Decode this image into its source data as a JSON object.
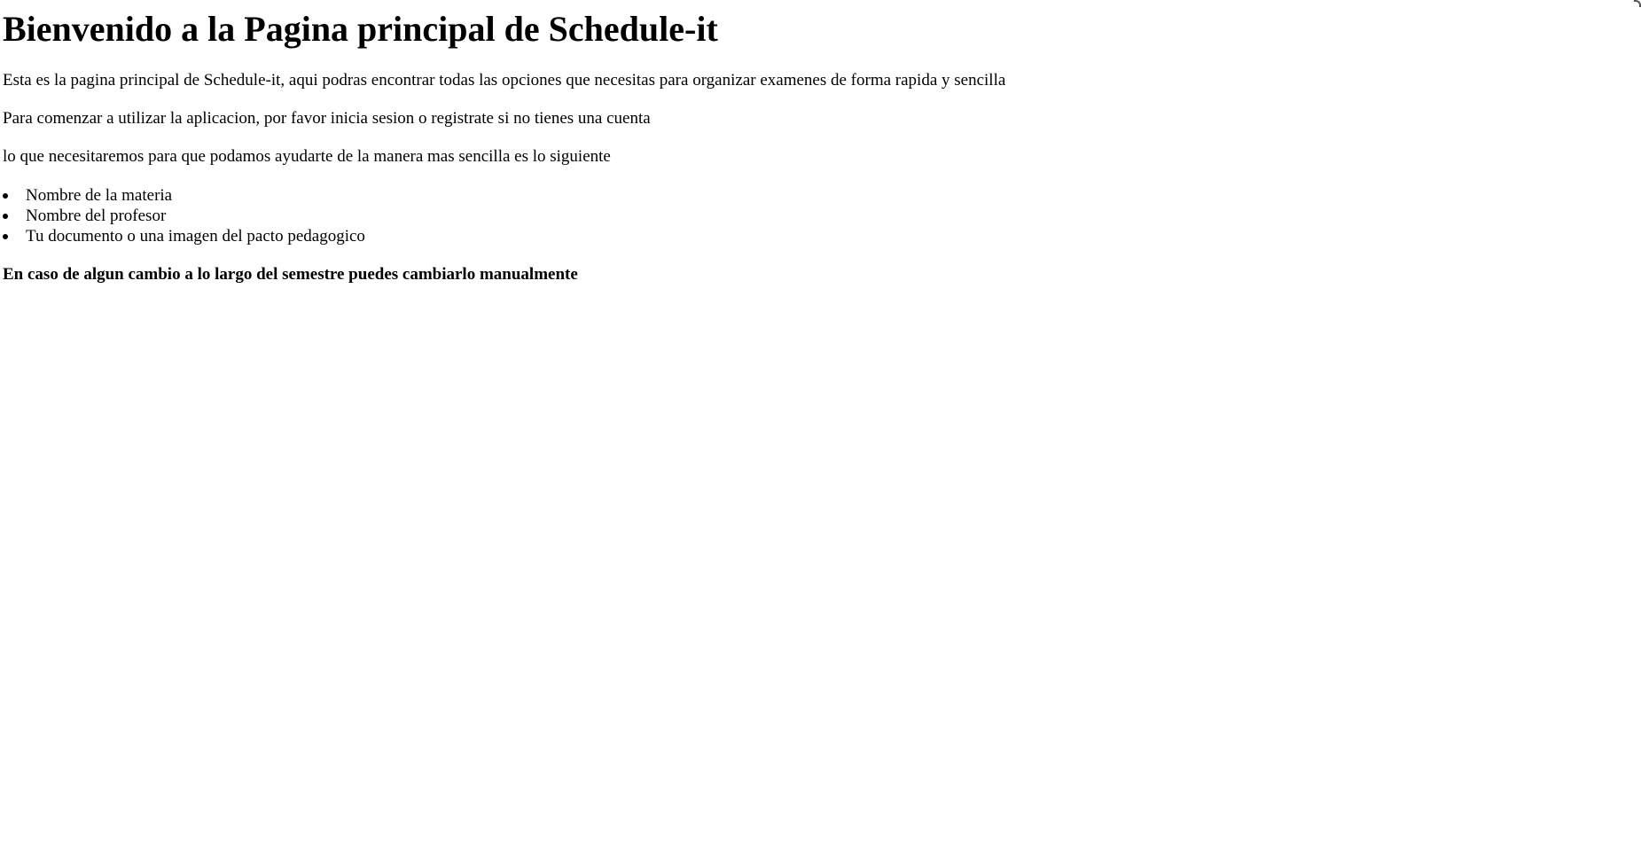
{
  "page": {
    "title": "Bienvenido a la Pagina principal de Schedule-it",
    "intro": "Esta es la pagina principal de Schedule-it, aqui podras encontrar todas las opciones que necesitas para organizar examenes de forma rapida y sencilla",
    "login_prompt": "Para comenzar a utilizar la aplicacion, por favor inicia sesion o registrate si no tienes una cuenta",
    "requirements_intro": "lo que necesitaremos para que podamos ayudarte de la manera mas sencilla es lo siguiente",
    "requirements": [
      "Nombre de la materia",
      "Nombre del profesor",
      "Tu documento o una imagen del pacto pedagogico"
    ],
    "note": "En caso de algun cambio a lo largo del semestre puedes cambiarlo manualmente"
  }
}
